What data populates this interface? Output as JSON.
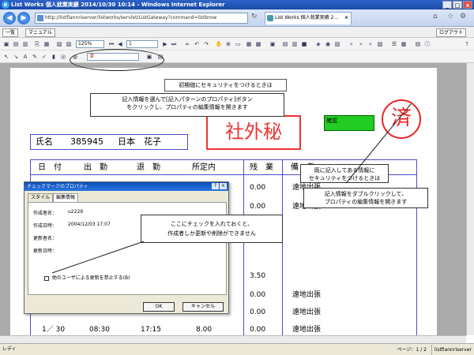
{
  "window": {
    "title": "List Works 個人就業実績 2014/10/30 10:14 - Windows Internet Explorer"
  },
  "address": {
    "url": "http://listfiannriserver/listworks/servlet/ListGateway?command=listbrow",
    "tab_label": "List Works 個人就業実績 2..."
  },
  "menubar": {
    "list_button": "一覧",
    "manual_button": "マニュアル",
    "logout_button": "ログアウト"
  },
  "toolbar": {
    "zoom": "125%",
    "page_input": "1",
    "stamp_select": "済"
  },
  "document": {
    "title_char": "章",
    "name_label": "氏名",
    "employee_id": "385945",
    "employee_name": "日本　花子",
    "stamp_shagai": "社外秘",
    "stamp_zumi": "済",
    "green_box_label": "確認",
    "headers": [
      "日　付",
      "出　勤",
      "退　勤",
      "所定内",
      "残　業",
      "備　考"
    ],
    "rows": [
      {
        "date": "",
        "in": "",
        "out": "",
        "reg": "",
        "ot": "0.00",
        "note": "遠地出張"
      },
      {
        "date": "",
        "in": "",
        "out": "",
        "reg": "",
        "ot": "0.00",
        "note": "遠地出張"
      },
      {
        "date": "",
        "in": "",
        "out": "",
        "reg": "",
        "ot": "",
        "note": ""
      },
      {
        "date": "",
        "in": "",
        "out": "",
        "reg": "",
        "ot": "",
        "note": ""
      },
      {
        "date": "",
        "in": "",
        "out": "",
        "reg": "",
        "ot": "3.50",
        "note": ""
      },
      {
        "date": "",
        "in": "",
        "out": "",
        "reg": "",
        "ot": "0.00",
        "note": "遠地出張"
      },
      {
        "date": "",
        "in": "",
        "out": "",
        "reg": "",
        "ot": "0.00",
        "note": "遠地出張"
      },
      {
        "date": "1／ 30",
        "in": "08:30",
        "out": "17:15",
        "reg": "8.00",
        "ot": "0.00",
        "note": "遠地出張"
      }
    ]
  },
  "callouts": {
    "initial_security": "初期値にセキュリティをつけるときは",
    "select_info": "記入情報を選んで[記入パターンのプロパティ]ボタン\nをクリックし、プロパティの編集情報を開きます",
    "existing_security": "既に記入してある情報に\nセキュリティをつけるときは",
    "double_click": "記入情報をダブルクリックして、\nプロパティの編集情報を開きます",
    "checkbox_note": "ここにチェックを入れておくと、\n作成者しか更新や削除ができません"
  },
  "dialog": {
    "title": "チェックマークのプロパティ",
    "tabs": [
      "スタイル",
      "編集情報"
    ],
    "creator_label": "作成者名：",
    "creator_value": "u2229",
    "created_label": "作成日時：",
    "created_value": "2004/12/03 17:07",
    "updater_label": "更新者名：",
    "updated_label": "更新日時：",
    "checkbox_label": "他のユーザによる更新を禁止する(B)",
    "ok_button": "OK",
    "cancel_button": "キャンセル"
  },
  "status": {
    "left": "レディ",
    "page": "ページ：1 / 2",
    "server": "listfiannriserver"
  }
}
